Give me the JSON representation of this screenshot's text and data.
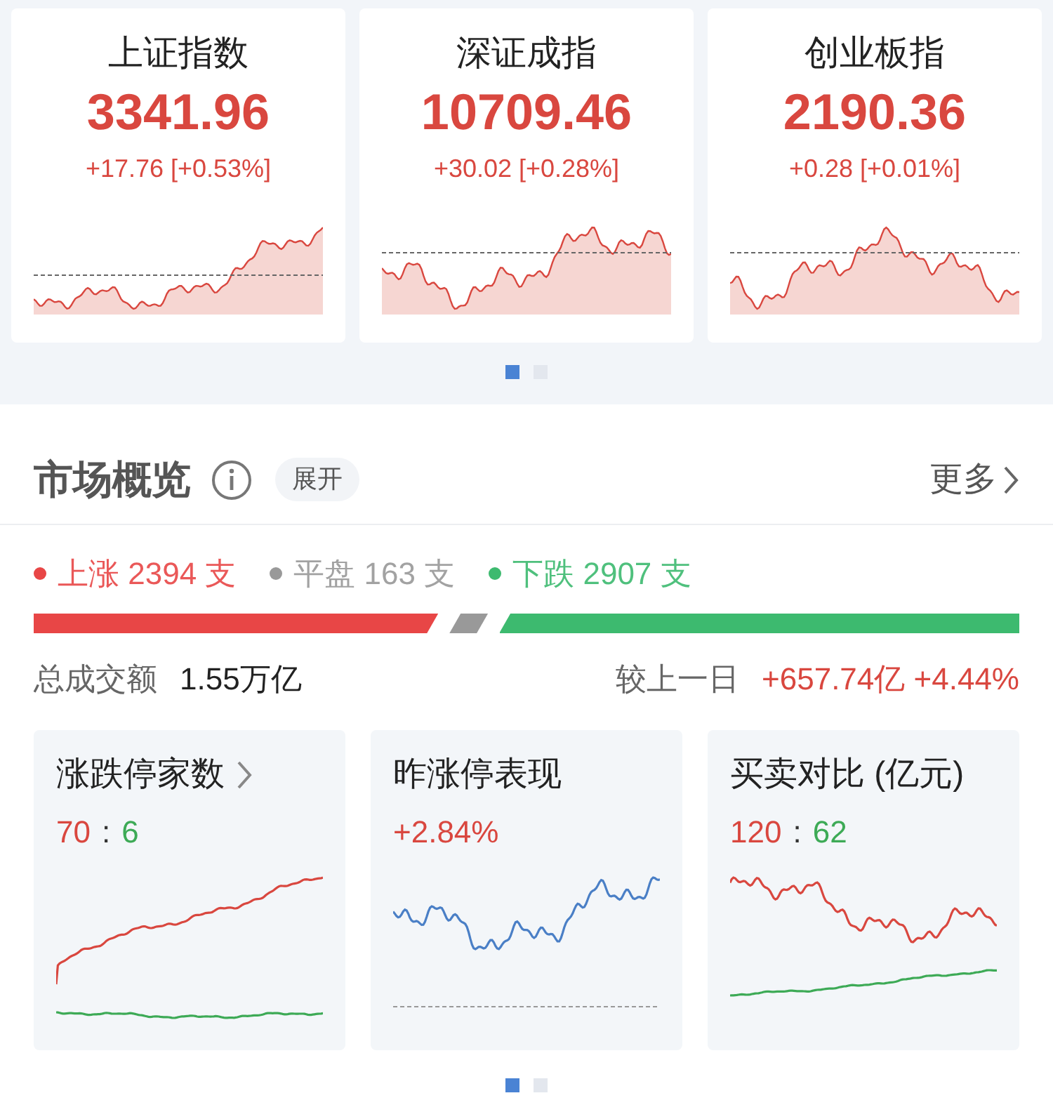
{
  "indices": [
    {
      "name": "上证指数",
      "value": "3341.96",
      "change": "+17.76 [+0.53%]"
    },
    {
      "name": "深证成指",
      "value": "10709.46",
      "change": "+30.02 [+0.28%]"
    },
    {
      "name": "创业板指",
      "value": "2190.36",
      "change": "+0.28 [+0.01%]"
    }
  ],
  "index_pager": [
    {
      "selected": true
    },
    {
      "selected": false
    }
  ],
  "overview": {
    "title": "市场概览",
    "expand_button": "展开",
    "more_link": "更多"
  },
  "breadth": [
    {
      "label": "上涨 2394 支",
      "color": "#e84646"
    },
    {
      "label": "平盘 163 支",
      "color": "#999999"
    },
    {
      "label": "下跌 2907 支",
      "color": "#3dba6f"
    }
  ],
  "turnover": {
    "label": "总成交额",
    "value": "1.55万亿",
    "compare_label": "较上一日",
    "change": "+657.74亿 +4.44%"
  },
  "mini_cards": [
    {
      "kind": "ratio",
      "title": "涨跌停家数",
      "has_arrow": true,
      "up": "70",
      "separator": ":",
      "down": "6"
    },
    {
      "kind": "percent",
      "title": "昨涨停表现",
      "has_arrow": false,
      "value": "+2.84%"
    },
    {
      "kind": "ratio",
      "title": "买卖对比 (亿元)",
      "has_arrow": false,
      "up": "120",
      "separator": ":",
      "down": "62"
    }
  ],
  "mini_pager": [
    {
      "selected": true
    },
    {
      "selected": false
    }
  ]
}
